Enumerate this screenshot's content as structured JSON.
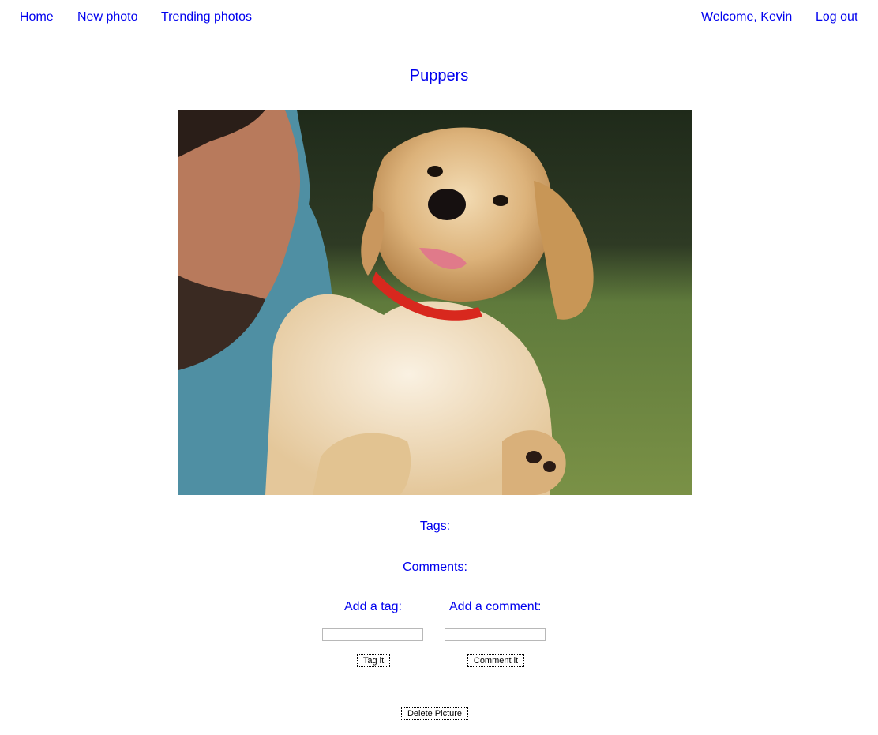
{
  "nav": {
    "left": [
      {
        "label": "Home"
      },
      {
        "label": "New photo"
      },
      {
        "label": "Trending photos"
      }
    ],
    "welcome": "Welcome, Kevin",
    "logout": "Log out"
  },
  "photo": {
    "title": "Puppers"
  },
  "details": {
    "tags_label": "Tags:",
    "comments_label": "Comments:"
  },
  "forms": {
    "tag_label": "Add a tag:",
    "tag_value": "",
    "tag_button": "Tag it",
    "comment_label": "Add a comment:",
    "comment_value": "",
    "comment_button": "Comment it"
  },
  "actions": {
    "delete_button": "Delete Picture"
  },
  "colors": {
    "link": "#0000ee",
    "nav_border": "#3fc8c8"
  }
}
